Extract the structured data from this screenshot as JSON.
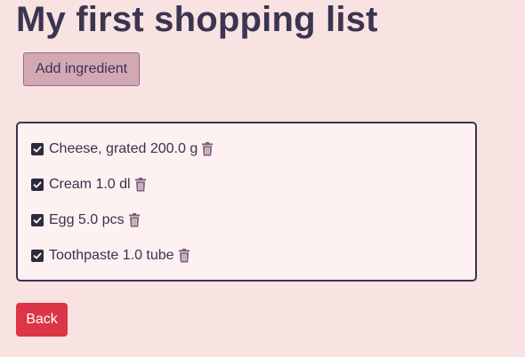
{
  "page": {
    "title": "My first shopping list"
  },
  "actions": {
    "add_label": "Add ingredient",
    "back_label": "Back"
  },
  "items": [
    {
      "text": "Cheese, grated 200.0 g",
      "checked": true
    },
    {
      "text": "Cream 1.0 dl",
      "checked": true
    },
    {
      "text": "Egg 5.0 pcs",
      "checked": true
    },
    {
      "text": "Toothpaste 1.0 tube",
      "checked": true
    }
  ],
  "icons": {
    "checkbox": "checkbox-checked-icon",
    "delete": "trash-icon"
  },
  "colors": {
    "background": "#f9e2e2",
    "text": "#38334f",
    "add_button": "#d3a8b4",
    "back_button": "#dc3545",
    "trash": "#7a5d78"
  }
}
